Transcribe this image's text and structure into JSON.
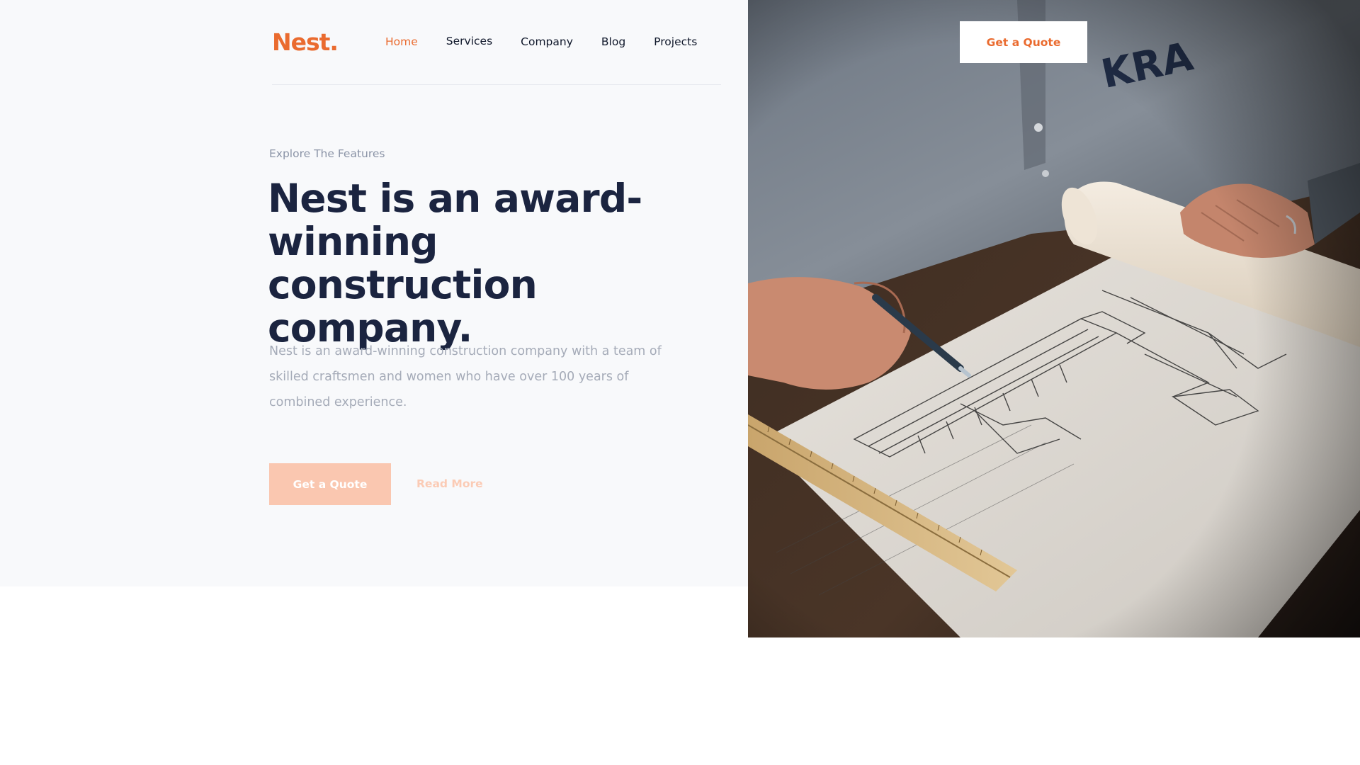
{
  "brand": {
    "logo_text": "Nest.",
    "accent_color": "#ea6b2f"
  },
  "nav": {
    "items": [
      {
        "label": "Home",
        "active": true
      },
      {
        "label": "Services",
        "active": false
      },
      {
        "label": "Company",
        "active": false
      },
      {
        "label": "Blog",
        "active": false
      },
      {
        "label": "Projects",
        "active": false
      }
    ]
  },
  "header": {
    "cta_label": "Get a Quote"
  },
  "hero": {
    "eyebrow": "Explore The Features",
    "headline": "Nest is an award-winning construction company.",
    "lead": "Nest is an award-winning construction company with a team of skilled craftsmen and women who have over 100 years of combined experience.",
    "primary_button": "Get a Quote",
    "secondary_link": "Read More"
  },
  "image": {
    "subject": "architect-drawing-blueprint-photo"
  }
}
